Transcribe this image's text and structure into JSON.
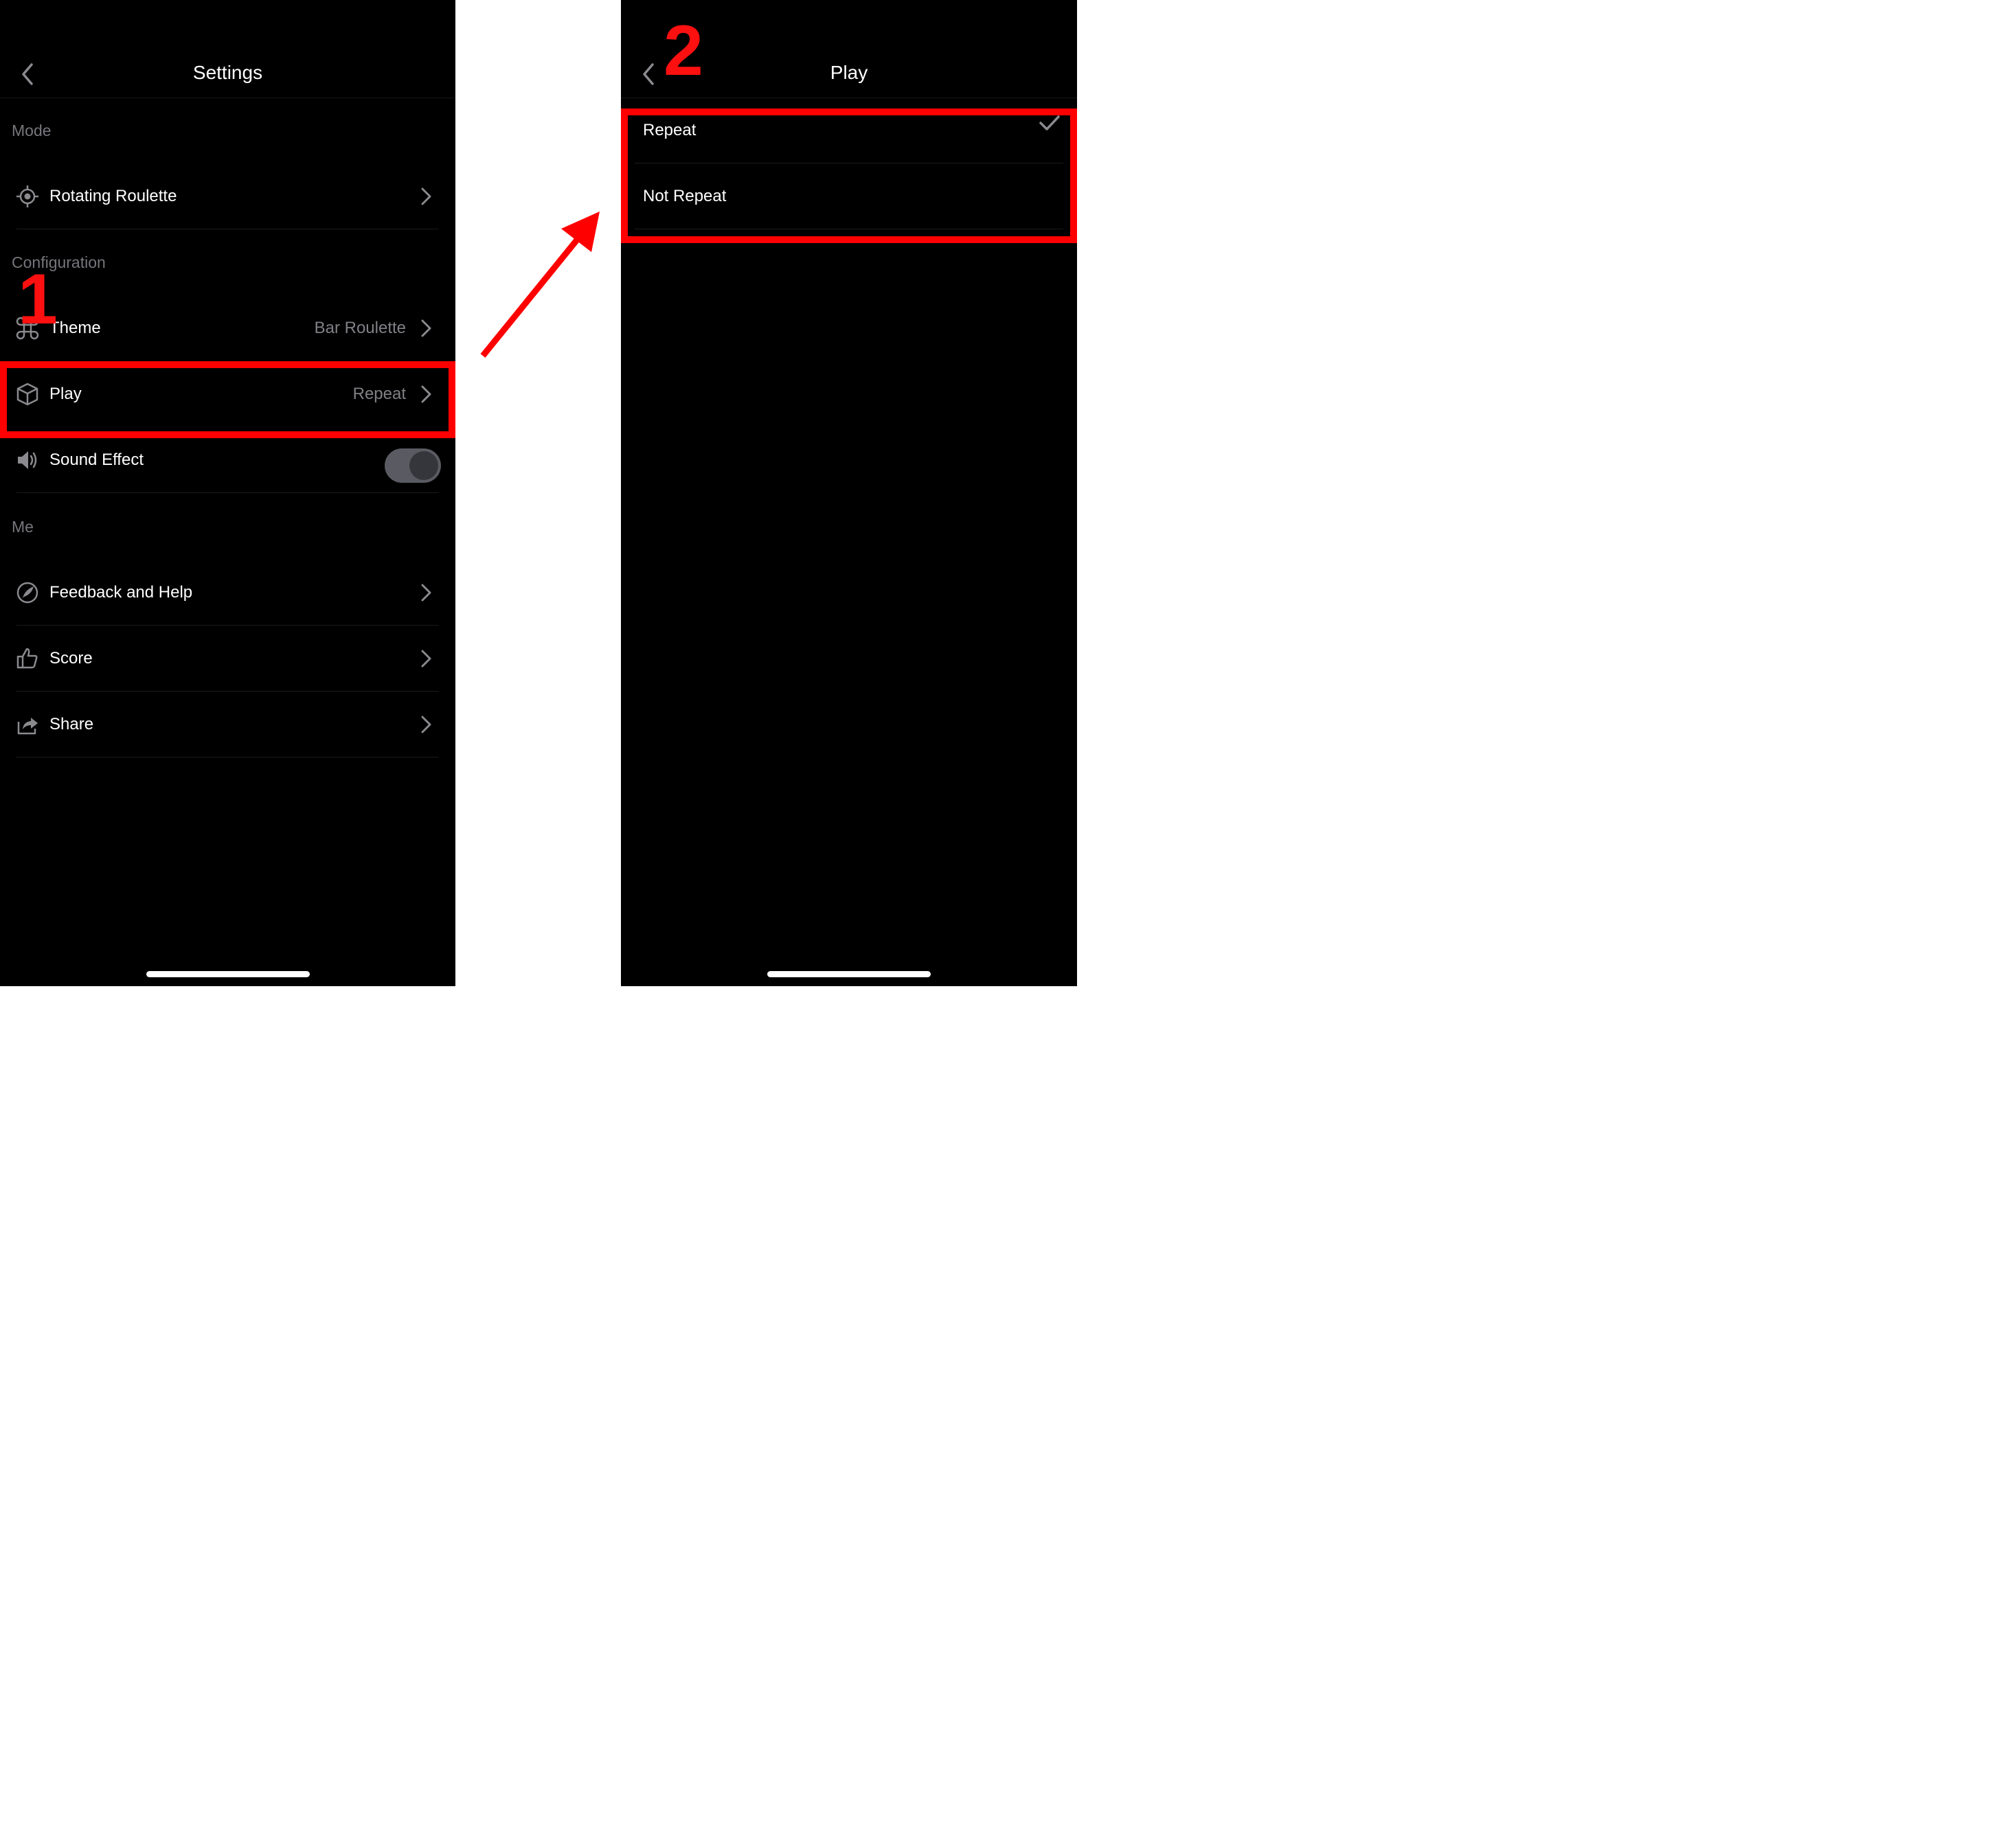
{
  "settings": {
    "title": "Settings",
    "sections": {
      "mode": "Mode",
      "configuration": "Configuration",
      "me": "Me"
    },
    "items": {
      "rotating": {
        "label": "Rotating Roulette",
        "icon": "target-icon"
      },
      "theme": {
        "label": "Theme",
        "value": "Bar Roulette",
        "icon": "command-icon"
      },
      "play": {
        "label": "Play",
        "value": "Repeat",
        "icon": "cube-icon"
      },
      "sound": {
        "label": "Sound Effect",
        "icon": "speaker-icon",
        "toggle_on": false
      },
      "feedback": {
        "label": "Feedback and Help",
        "icon": "feather-icon"
      },
      "score": {
        "label": "Score",
        "icon": "thumbs-up-icon"
      },
      "share": {
        "label": "Share",
        "icon": "share-icon"
      }
    }
  },
  "play_screen": {
    "title": "Play",
    "options": [
      {
        "label": "Repeat",
        "selected": true
      },
      {
        "label": "Not Repeat",
        "selected": false
      }
    ]
  },
  "annotations": {
    "step1": "1",
    "step2": "2",
    "color": "#ff0000"
  }
}
